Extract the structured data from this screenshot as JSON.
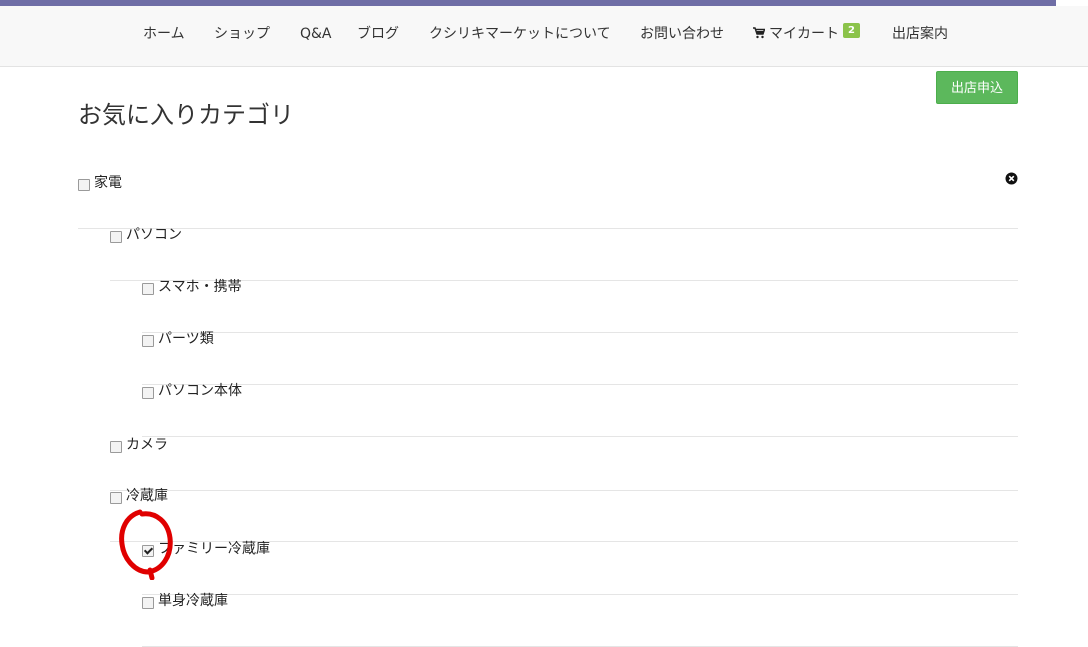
{
  "nav": {
    "items": [
      "ホーム",
      "ショップ",
      "Q&A",
      "ブログ",
      "クシリキマーケットについて",
      "お問い合わせ"
    ],
    "cart_label": "マイカート",
    "cart_count": "2",
    "store_guide": "出店案内"
  },
  "apply_button": "出店申込",
  "page_title": "お気に入りカテゴリ",
  "categories": [
    {
      "label": "家電",
      "checked": false
    },
    {
      "label": "パソコン",
      "checked": false
    },
    {
      "label": "スマホ・携帯",
      "checked": false
    },
    {
      "label": "パーツ類",
      "checked": false
    },
    {
      "label": "パソコン本体",
      "checked": false
    },
    {
      "label": "カメラ",
      "checked": false
    },
    {
      "label": "冷蔵庫",
      "checked": false
    },
    {
      "label": "ファミリー冷蔵庫",
      "checked": true
    },
    {
      "label": "単身冷蔵庫",
      "checked": false
    }
  ],
  "colors": {
    "accent_bar": "#6f6ea6",
    "apply_button": "#5cb85c",
    "cart_badge": "#8bc34a",
    "annotation": "#e00000"
  },
  "icons": [
    "cart-icon",
    "remove-icon"
  ]
}
